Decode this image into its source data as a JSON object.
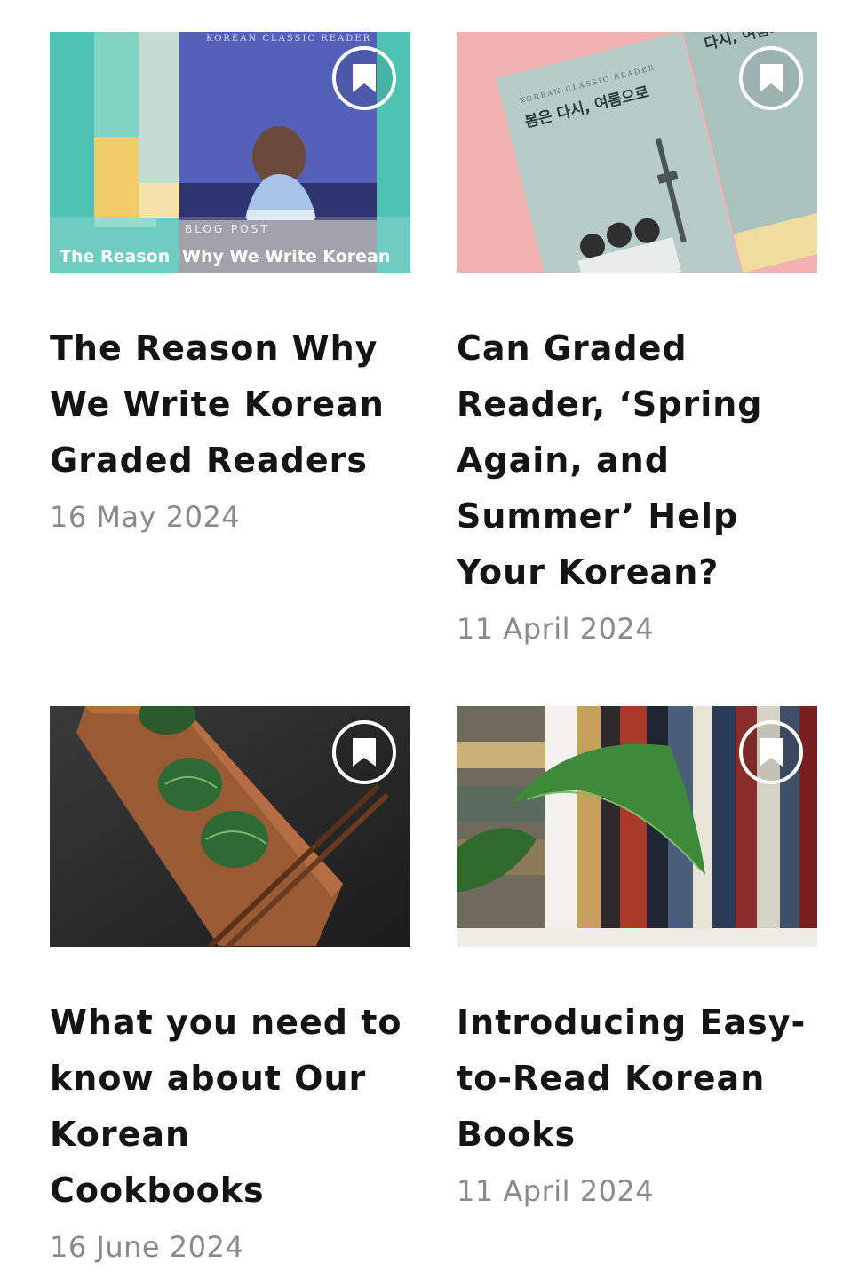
{
  "posts": [
    {
      "title": "The Reason Why We Write Korean Graded Readers",
      "date": "16 May 2024",
      "image": {
        "series_label": "KOREAN CLASSIC READER",
        "tag": "BLOG POST",
        "caption_left": "The Reason",
        "caption_right": "Why We Write Korean"
      }
    },
    {
      "title": "Can Graded Reader, ‘Spring Again, and Summer’ Help Your Korean?",
      "date": "11 April 2024",
      "image": {
        "series_label": "KOREAN CLASSIC READER",
        "book_title_ko": "봄은 다시, 여름으로",
        "book_title_ko_2": "다시, 여름으로"
      }
    },
    {
      "title": "What you need to know about Our Korean Cookbooks",
      "date": "16 June 2024"
    },
    {
      "title": "Introducing Easy-to-Read Korean Books",
      "date": "11 April 2024"
    }
  ],
  "icons": {
    "bookmark": "bookmark-icon"
  },
  "colors": {
    "title": "#141414",
    "date": "#8a8a8a",
    "bookmark_ring": "#ffffff"
  }
}
